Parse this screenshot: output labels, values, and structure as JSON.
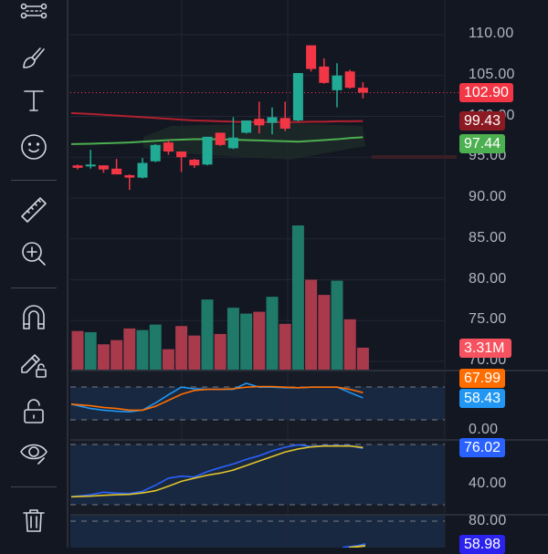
{
  "toolbar": {
    "tools": [
      {
        "name": "trend-line-tools",
        "icon": "node-lines-icon"
      },
      {
        "name": "brush",
        "icon": "brush-icon"
      },
      {
        "name": "text",
        "icon": "text-icon"
      },
      {
        "name": "emoji",
        "icon": "smiley-icon"
      },
      {
        "name": "measure",
        "icon": "ruler-icon"
      },
      {
        "name": "zoom-in",
        "icon": "zoom-in-icon"
      },
      {
        "name": "magnet",
        "icon": "magnet-icon"
      },
      {
        "name": "lock-drawings",
        "icon": "pencil-lock-icon"
      },
      {
        "name": "lock-all",
        "icon": "unlock-icon"
      },
      {
        "name": "hide-drawings",
        "icon": "eye-icon"
      },
      {
        "name": "remove-drawings",
        "icon": "trash-icon"
      }
    ]
  },
  "price_axis": {
    "labels": [
      "110.00",
      "105.00",
      "100.00",
      "95.00",
      "90.00",
      "85.00",
      "80.00",
      "75.00",
      "70.00"
    ],
    "values": [
      110,
      105,
      100,
      95,
      90,
      85,
      80,
      75,
      70
    ]
  },
  "tags": {
    "last_price": "102.90",
    "ma_slow": "99.43",
    "ma_fast": "97.44",
    "volume": "3.31M",
    "osc1_a": "67.99",
    "osc1_b": "58.43",
    "osc1_zero": "0.00",
    "osc2_a": "76.02",
    "osc2_axis": "40.00",
    "osc3_axis": "80.00",
    "osc3_a": "58.98"
  },
  "colors": {
    "up": "#22ab94",
    "down": "#f23645",
    "vol_up": "#1f7a6a",
    "vol_down": "#a83a4c",
    "ma_slow": "#b2202e",
    "ma_fast": "#4caf50",
    "blue": "#2196f3",
    "orange": "#ff6d00",
    "royal": "#2962ff",
    "yellow": "#e0c32a"
  },
  "chart_data": {
    "type": "candlestick",
    "last_price": 102.9,
    "ohlc": [
      [
        94.0,
        94.1,
        93.5,
        93.7
      ],
      [
        93.9,
        95.9,
        93.6,
        94.1
      ],
      [
        94.0,
        94.0,
        93.1,
        93.5
      ],
      [
        93.6,
        94.8,
        92.9,
        92.9
      ],
      [
        92.8,
        92.9,
        91.0,
        92.5
      ],
      [
        92.5,
        94.9,
        92.4,
        94.3
      ],
      [
        94.5,
        96.6,
        94.4,
        96.5
      ],
      [
        96.8,
        97.1,
        95.3,
        95.7
      ],
      [
        95.7,
        95.7,
        93.2,
        95.0
      ],
      [
        94.7,
        94.8,
        93.7,
        94.0
      ],
      [
        94.1,
        97.5,
        94.0,
        97.5
      ],
      [
        98.0,
        98.0,
        96.4,
        96.5
      ],
      [
        96.1,
        99.9,
        96.0,
        97.4
      ],
      [
        98.0,
        99.5,
        97.9,
        99.5
      ],
      [
        99.7,
        101.8,
        97.9,
        98.9
      ],
      [
        99.2,
        101.1,
        97.8,
        99.9
      ],
      [
        99.8,
        101.8,
        98.2,
        98.5
      ],
      [
        99.5,
        105.3,
        99.4,
        105.3
      ],
      [
        108.7,
        108.7,
        105.5,
        105.8
      ],
      [
        106.1,
        107.1,
        104.0,
        104.1
      ],
      [
        103.2,
        106.5,
        101.1,
        105.0
      ],
      [
        105.5,
        105.7,
        103.4,
        103.5
      ],
      [
        103.5,
        104.2,
        102.2,
        102.9
      ]
    ],
    "ma_slow": [
      100.4,
      100.3,
      100.2,
      100.1,
      100.0,
      99.9,
      99.8,
      99.7,
      99.6,
      99.5,
      99.45,
      99.4,
      99.35,
      99.3,
      99.3,
      99.3,
      99.3,
      99.3,
      99.35,
      99.35,
      99.4,
      99.4,
      99.43
    ],
    "ma_fast": [
      96.6,
      96.65,
      96.7,
      96.75,
      96.8,
      96.9,
      97.0,
      97.1,
      97.15,
      97.2,
      97.2,
      97.2,
      97.15,
      97.1,
      97.05,
      97.0,
      96.95,
      96.9,
      97.0,
      97.1,
      97.2,
      97.35,
      97.44
    ],
    "volume_m": [
      5.83,
      5.65,
      3.82,
      4.45,
      6.21,
      5.97,
      6.8,
      3.08,
      6.58,
      5.14,
      10.58,
      5.38,
      9.34,
      8.45,
      8.73,
      10.99,
      6.9,
      21.75,
      13.56,
      11.27,
      13.42,
      7.59,
      3.31
    ],
    "osc1": {
      "bands": [
        80,
        20
      ],
      "series_a": [
        47,
        44,
        41,
        39,
        36,
        36,
        43,
        54,
        65,
        72,
        74,
        74,
        75,
        78,
        79,
        79,
        78,
        77,
        78,
        78,
        78,
        74,
        67.99
      ],
      "series_b": [
        47,
        39,
        36,
        34,
        33,
        36,
        49,
        64,
        78,
        75,
        74,
        74,
        74,
        85,
        78,
        78,
        77,
        77,
        78,
        78,
        78,
        68,
        58.43
      ]
    },
    "osc2": {
      "bands": [
        80,
        20
      ],
      "series_a": [
        27.9,
        30,
        32.4,
        31.5,
        31.2,
        33.3,
        39.4,
        46.4,
        48.5,
        47.6,
        53,
        57,
        60.6,
        65.1,
        68.8,
        73.6,
        77.3,
        79.7,
        77.9,
        78.8,
        78.8,
        78.8,
        76.02
      ],
      "series_b": [
        27.9,
        28.6,
        29.4,
        29.9,
        30.3,
        31.8,
        33.9,
        38.4,
        43.3,
        46.4,
        49.4,
        51.5,
        54.5,
        59,
        63.5,
        68,
        72.5,
        75.5,
        77.6,
        78.5,
        78.5,
        78.5,
        77
      ]
    }
  }
}
